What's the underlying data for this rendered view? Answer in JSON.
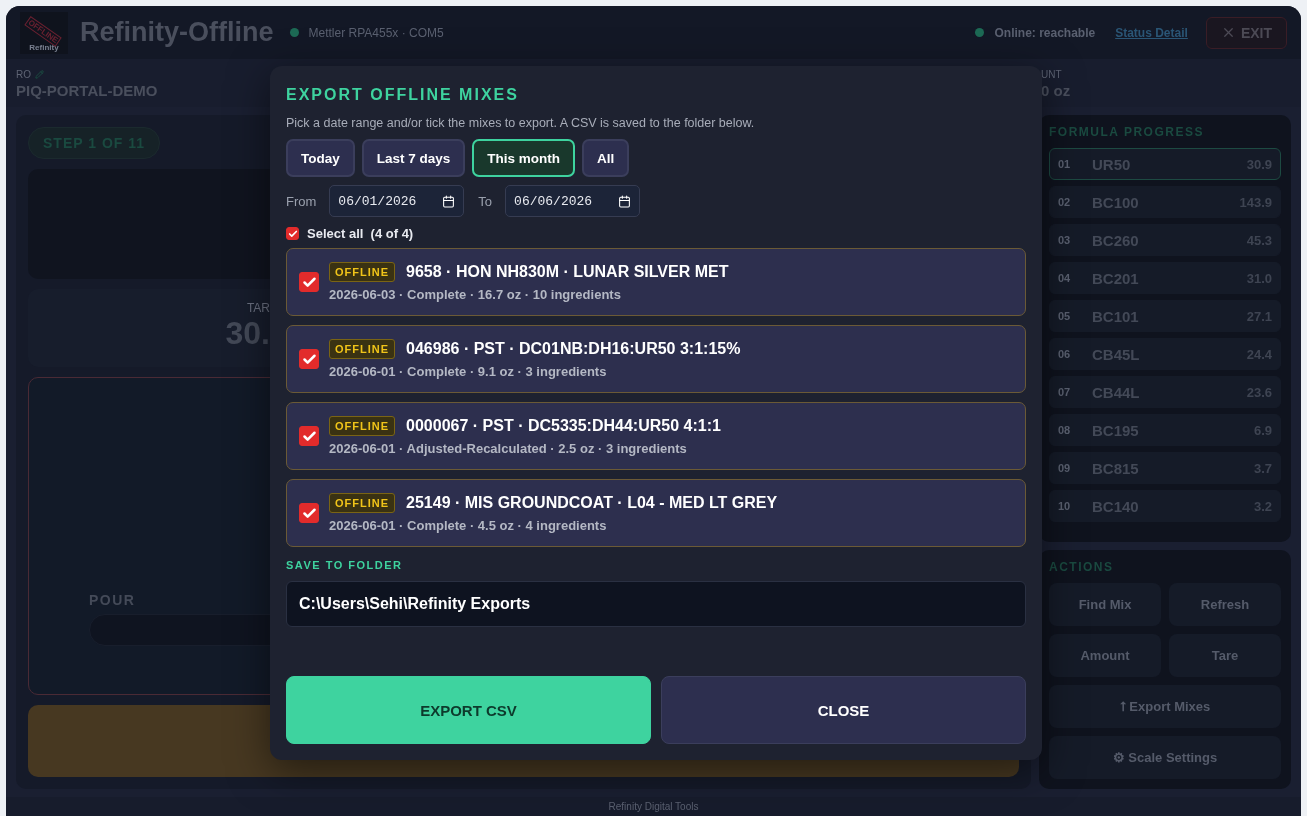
{
  "app": {
    "title": "Refinity-Offline",
    "logo_stamp": "OFFLINE",
    "logo_text": "Refinity"
  },
  "device": {
    "name": "Mettler RPA455x · COM5",
    "connected": true
  },
  "status": {
    "text": "Online: reachable",
    "online": true,
    "link": "Status Detail"
  },
  "exit_button": {
    "label": "EXIT"
  },
  "ro": {
    "label": "RO",
    "value": "PIQ-PORTAL-DEMO"
  },
  "amount": {
    "label": "UNT",
    "value": "0 oz"
  },
  "step": "STEP 1 OF 11",
  "target": {
    "label": "TAR",
    "value": "30."
  },
  "pour": {
    "label": "POUR"
  },
  "formula_progress": {
    "title": "FORMULA PROGRESS",
    "items": [
      {
        "index": "01",
        "code": "UR50",
        "amount": "30.9",
        "selected": true
      },
      {
        "index": "02",
        "code": "BC100",
        "amount": "143.9",
        "selected": false
      },
      {
        "index": "03",
        "code": "BC260",
        "amount": "45.3",
        "selected": false
      },
      {
        "index": "04",
        "code": "BC201",
        "amount": "31.0",
        "selected": false
      },
      {
        "index": "05",
        "code": "BC101",
        "amount": "27.1",
        "selected": false
      },
      {
        "index": "06",
        "code": "CB45L",
        "amount": "24.4",
        "selected": false
      },
      {
        "index": "07",
        "code": "CB44L",
        "amount": "23.6",
        "selected": false
      },
      {
        "index": "08",
        "code": "BC195",
        "amount": "6.9",
        "selected": false
      },
      {
        "index": "09",
        "code": "BC815",
        "amount": "3.7",
        "selected": false
      },
      {
        "index": "10",
        "code": "BC140",
        "amount": "3.2",
        "selected": false
      }
    ]
  },
  "actions": {
    "title": "ACTIONS",
    "buttons": [
      {
        "label": "Find Mix",
        "wide": false
      },
      {
        "label": "Refresh",
        "wide": false
      },
      {
        "label": "Amount",
        "wide": false
      },
      {
        "label": "Tare",
        "wide": false
      },
      {
        "label": "⭡ Export Mixes",
        "wide": true
      },
      {
        "label": "⚙ Scale Settings",
        "wide": true
      }
    ]
  },
  "footer": "Refinity Digital Tools",
  "dialog": {
    "title": "EXPORT OFFLINE MIXES",
    "hint": "Pick a date range and/or tick the mixes to export. A CSV is saved to the folder below.",
    "ranges": [
      {
        "label": "Today",
        "selected": false
      },
      {
        "label": "Last 7 days",
        "selected": false
      },
      {
        "label": "This month",
        "selected": true
      },
      {
        "label": "All",
        "selected": false
      }
    ],
    "from": {
      "label": "From",
      "value": "06/01/2026"
    },
    "to": {
      "label": "To",
      "value": "06/06/2026"
    },
    "select_all": {
      "label": "Select all",
      "count": "(4 of 4)",
      "checked": true
    },
    "mixes": [
      {
        "checked": true,
        "badge": "OFFLINE",
        "title": "9658 · HON NH830M · LUNAR SILVER MET",
        "details": "2026-06-03 · Complete · 16.7 oz · 10 ingredients"
      },
      {
        "checked": true,
        "badge": "OFFLINE",
        "title": "046986 · PST · DC01NB:DH16:UR50 3:1:15%",
        "details": "2026-06-01 · Complete · 9.1 oz · 3 ingredients"
      },
      {
        "checked": true,
        "badge": "OFFLINE",
        "title": "0000067 · PST · DC5335:DH44:UR50 4:1:1",
        "details": "2026-06-01 · Adjusted-Recalculated · 2.5 oz · 3 ingredients"
      },
      {
        "checked": true,
        "badge": "OFFLINE",
        "title": "25149 · MIS GROUNDCOAT · L04 - MED LT GREY",
        "details": "2026-06-01 · Complete · 4.5 oz · 4 ingredients"
      }
    ],
    "folder": {
      "label": "SAVE TO FOLDER",
      "value": "C:\\Users\\Sehi\\Refinity Exports"
    },
    "buttons": [
      {
        "label": "EXPORT CSV",
        "kind": "primary"
      },
      {
        "label": "CLOSE",
        "kind": "secondary"
      }
    ]
  }
}
